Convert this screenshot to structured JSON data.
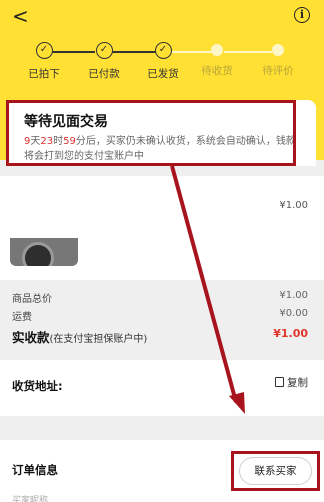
{
  "header": {
    "back": "<",
    "info": "i"
  },
  "steps": [
    {
      "label": "已拍下",
      "done": true
    },
    {
      "label": "已付款",
      "done": true
    },
    {
      "label": "已发货",
      "done": true
    },
    {
      "label": "待收货",
      "done": false
    },
    {
      "label": "待评价",
      "done": false
    }
  ],
  "status": {
    "title": "等待见面交易",
    "days": "9",
    "days_unit": "天",
    "hours": "23",
    "hours_unit": "时",
    "minutes": "59",
    "desc_rest": "分后，买家仍未确认收货，系统会自动确认，钱款将会打到您的支付宝账户中"
  },
  "goods": {
    "price": "¥1.00"
  },
  "summary": {
    "goods_total_label": "商品总价",
    "goods_total_value": "¥1.00",
    "shipping_label": "运费",
    "shipping_value": "¥0.00",
    "paid_label": "实收款",
    "paid_note": "(在支付宝担保账户中)",
    "paid_value": "¥1.00"
  },
  "address": {
    "label": "收货地址:",
    "copy_label": "复制"
  },
  "order": {
    "label": "订单信息",
    "contact_label": "联系买家",
    "cut_text": "买家昵称"
  },
  "colors": {
    "header_bg": "#ffe033",
    "highlight": "#a8141e",
    "price_red": "#e0352b"
  }
}
